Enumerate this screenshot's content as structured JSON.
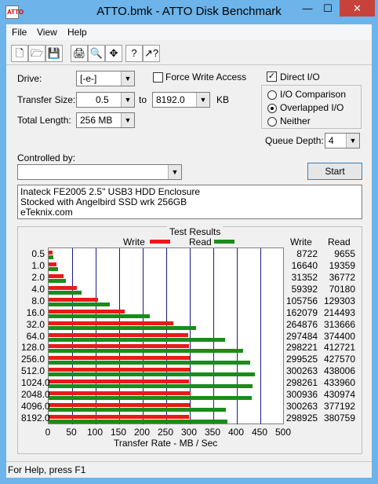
{
  "window": {
    "title": "ATTO.bmk - ATTO Disk Benchmark",
    "minimize": "—",
    "maximize": "☐",
    "close": "✕"
  },
  "menu": [
    "File",
    "View",
    "Help"
  ],
  "toolbar": [
    "new-icon",
    "open-icon",
    "save-icon",
    "print-icon",
    "print-preview-icon",
    "move-icon",
    "help-icon",
    "context-help-icon"
  ],
  "settings": {
    "drive_label": "Drive:",
    "drive_value": "[-e-]",
    "force_write_label": "Force Write Access",
    "force_write_checked": false,
    "direct_io_label": "Direct I/O",
    "direct_io_checked": true,
    "transfer_size_label": "Transfer Size:",
    "transfer_from": "0.5",
    "to_label": "to",
    "transfer_to": "8192.0",
    "kb_label": "KB",
    "total_length_label": "Total Length:",
    "total_length_value": "256 MB",
    "io_comparison_label": "I/O Comparison",
    "overlapped_io_label": "Overlapped I/O",
    "neither_label": "Neither",
    "selected_io_mode": "Overlapped I/O",
    "queue_depth_label": "Queue Depth:",
    "queue_depth_value": "4",
    "controlled_by_label": "Controlled by:",
    "controlled_by_value": "",
    "start_label": "Start"
  },
  "description": [
    "Inateck FE2005 2.5\" USB3 HDD Enclosure",
    "Stocked with Angelbird SSD wrk 256GB",
    "eTeknix.com"
  ],
  "results": {
    "title": "Test Results",
    "write_legend": "Write",
    "read_legend": "Read",
    "write_col": "Write",
    "read_col": "Read",
    "xlabel": "Transfer Rate - MB / Sec",
    "colors": {
      "write": "#e81a1a",
      "read": "#1a8c1a",
      "grid": "#1a1a8c"
    }
  },
  "chart_data": {
    "type": "bar",
    "categories": [
      "0.5",
      "1.0",
      "2.0",
      "4.0",
      "8.0",
      "16.0",
      "32.0",
      "64.0",
      "128.0",
      "256.0",
      "512.0",
      "1024.0",
      "2048.0",
      "4096.0",
      "8192.0"
    ],
    "series": [
      {
        "name": "Write",
        "values": [
          8722,
          16640,
          31352,
          59392,
          105756,
          162079,
          264876,
          297484,
          298221,
          299525,
          300263,
          298261,
          300936,
          300263,
          298925
        ]
      },
      {
        "name": "Read",
        "values": [
          9655,
          19359,
          36772,
          70180,
          129303,
          214493,
          313666,
          374400,
          412721,
          427570,
          438006,
          433960,
          430974,
          377192,
          380759
        ]
      }
    ],
    "x_ticks": [
      "0",
      "50",
      "100",
      "150",
      "200",
      "250",
      "300",
      "350",
      "400",
      "450",
      "500"
    ],
    "xlim": [
      0,
      500
    ],
    "xlabel": "Transfer Rate - MB / Sec",
    "legend": "top"
  },
  "status": "For Help, press F1"
}
